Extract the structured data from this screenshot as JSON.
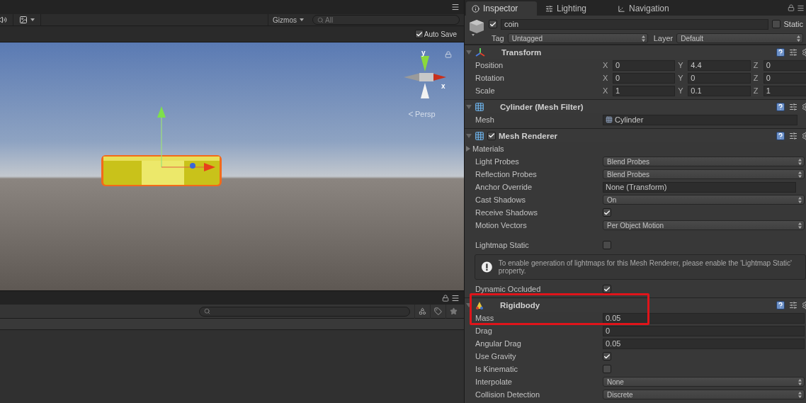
{
  "scene": {
    "toolbar": {
      "gizmos": "Gizmos",
      "search_placeholder": "All"
    },
    "auto_save": {
      "label": "Auto Save",
      "checked": true
    },
    "orientation_gizmo": {
      "y_label": "y",
      "x_label": "x",
      "projection": "Persp"
    }
  },
  "inspector": {
    "tabs": [
      {
        "label": "Inspector",
        "kind": "info",
        "selected": true
      },
      {
        "label": "Lighting",
        "kind": "lighting",
        "selected": false
      },
      {
        "label": "Navigation",
        "kind": "navigation",
        "selected": false
      }
    ],
    "object": {
      "active": true,
      "name": "coin",
      "static_label": "Static",
      "static": false,
      "tag_label": "Tag",
      "tag": "Untagged",
      "layer_label": "Layer",
      "layer": "Default"
    },
    "components": [
      {
        "title": "Transform",
        "kind": "transform",
        "rows": [
          {
            "label": "Position",
            "kind": "vector",
            "axes": [
              "X",
              "Y",
              "Z"
            ],
            "values": [
              "0",
              "4.4",
              "0"
            ]
          },
          {
            "label": "Rotation",
            "kind": "vector",
            "axes": [
              "X",
              "Y",
              "Z"
            ],
            "values": [
              "0",
              "0",
              "0"
            ]
          },
          {
            "label": "Scale",
            "kind": "vector",
            "axes": [
              "X",
              "Y",
              "Z"
            ],
            "values": [
              "1",
              "0.1",
              "1"
            ]
          }
        ]
      },
      {
        "title": "Cylinder (Mesh Filter)",
        "kind": "mesh_filter",
        "rows": [
          {
            "label": "Mesh",
            "kind": "object",
            "value": "Cylinder"
          }
        ]
      },
      {
        "title": "Mesh Renderer",
        "kind": "mesh_renderer",
        "enabled": true,
        "rows": [
          {
            "label": "Materials",
            "kind": "foldout",
            "expanded": false
          },
          {
            "label": "Light Probes",
            "kind": "dropdown",
            "value": "Blend Probes"
          },
          {
            "label": "Reflection Probes",
            "kind": "dropdown",
            "value": "Blend Probes"
          },
          {
            "label": "Anchor Override",
            "kind": "field",
            "value": "None (Transform)"
          },
          {
            "label": "Cast Shadows",
            "kind": "dropdown",
            "value": "On"
          },
          {
            "label": "Receive Shadows",
            "kind": "checkbox",
            "checked": true
          },
          {
            "label": "Motion Vectors",
            "kind": "dropdown",
            "value": "Per Object Motion"
          },
          {
            "label": "Lightmap Static",
            "kind": "checkbox",
            "checked": false
          },
          {
            "kind": "help",
            "text": "To enable generation of lightmaps for this Mesh Renderer, please enable the 'Lightmap Static' property."
          },
          {
            "label": "Dynamic Occluded",
            "kind": "checkbox",
            "checked": true
          }
        ]
      },
      {
        "title": "Rigidbody",
        "kind": "rigidbody",
        "rows": [
          {
            "label": "Mass",
            "kind": "number",
            "value": "0.05"
          },
          {
            "label": "Drag",
            "kind": "number",
            "value": "0"
          },
          {
            "label": "Angular Drag",
            "kind": "number",
            "value": "0.05"
          },
          {
            "label": "Use Gravity",
            "kind": "checkbox",
            "checked": true
          },
          {
            "label": "Is Kinematic",
            "kind": "checkbox",
            "checked": false
          },
          {
            "label": "Interpolate",
            "kind": "dropdown",
            "value": "None"
          },
          {
            "label": "Collision Detection",
            "kind": "dropdown",
            "value": "Discrete"
          }
        ]
      }
    ]
  }
}
